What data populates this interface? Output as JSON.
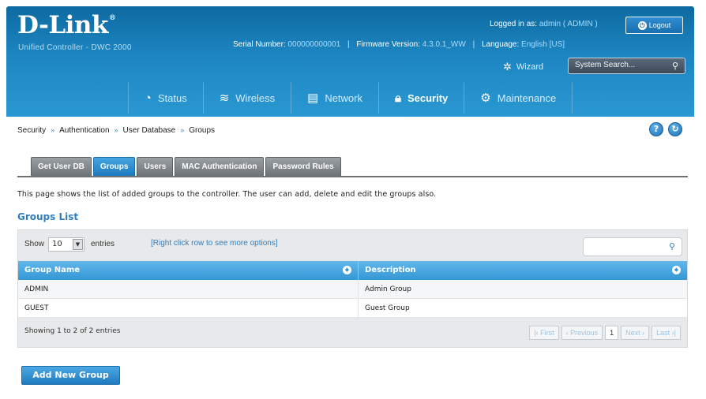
{
  "header": {
    "logo_text": "D-Link",
    "logo_mark": "®",
    "subtitle": "Unified Controller - DWC 2000",
    "logged_in_label": "Logged in as:",
    "logged_in_user": "admin ( ADMIN )",
    "logout_label": "Logout",
    "serial_label": "Serial Number:",
    "serial_value": "000000000001",
    "firmware_label": "Firmware Version:",
    "firmware_value": "4.3.0.1_WW",
    "language_label": "Language:",
    "language_value": "English [US]",
    "wizard_label": "Wizard",
    "search_placeholder": "System Search...",
    "accent_color": "#1d86c2"
  },
  "nav": {
    "items": [
      {
        "label": "Status",
        "icon": "gauge-icon",
        "active": false
      },
      {
        "label": "Wireless",
        "icon": "wifi-icon",
        "active": false
      },
      {
        "label": "Network",
        "icon": "monitor-icon",
        "active": false
      },
      {
        "label": "Security",
        "icon": "lock-icon",
        "active": true
      },
      {
        "label": "Maintenance",
        "icon": "gears-icon",
        "active": false
      }
    ]
  },
  "breadcrumb": [
    "Security",
    "Authentication",
    "User Database",
    "Groups"
  ],
  "tabs": [
    {
      "label": "Get User DB",
      "active": false
    },
    {
      "label": "Groups",
      "active": true
    },
    {
      "label": "Users",
      "active": false
    },
    {
      "label": "MAC Authentication",
      "active": false
    },
    {
      "label": "Password Rules",
      "active": false
    }
  ],
  "page": {
    "description": "This page shows the list of added groups to the controller. The user can add, delete and edit the groups also.",
    "section_title": "Groups List"
  },
  "table": {
    "show_label": "Show",
    "show_value": "10",
    "entries_label": "entries",
    "hint": "[Right click row to see more options]",
    "columns": [
      "Group Name",
      "Description"
    ],
    "rows": [
      [
        "ADMIN",
        "Admin Group"
      ],
      [
        "GUEST",
        "Guest Group"
      ]
    ],
    "showing": "Showing 1 to 2 of 2 entries",
    "pager": {
      "first": "First",
      "previous": "Previous",
      "current": "1",
      "next": "Next",
      "last": "Last"
    }
  },
  "actions": {
    "add_group": "Add New Group"
  }
}
